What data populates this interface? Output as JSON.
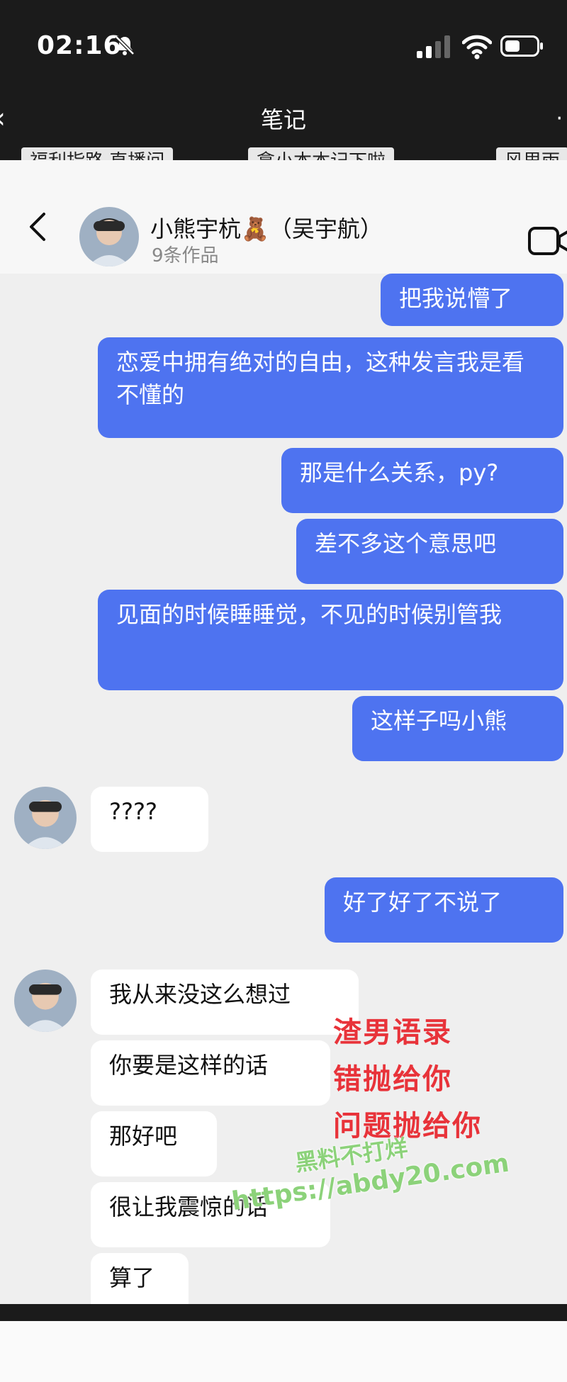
{
  "status_bar": {
    "time": "02:16"
  },
  "top_nav": {
    "title": "笔记"
  },
  "tabs": [
    "福利指路 直播间",
    "拿小本本记下啦",
    "风里雨"
  ],
  "chat_header": {
    "name": "小熊宇杭🧸（吴宇航）",
    "subtitle": "9条作品"
  },
  "messages": [
    {
      "side": "sent",
      "text": "把我说懵了"
    },
    {
      "side": "sent",
      "text": "恋爱中拥有绝对的自由，这种发言我是看不懂的"
    },
    {
      "side": "sent",
      "text": "那是什么关系，py?"
    },
    {
      "side": "sent",
      "text": "差不多这个意思吧"
    },
    {
      "side": "sent",
      "text": "见面的时候睡睡觉，不见的时候别管我"
    },
    {
      "side": "sent",
      "text": "这样子吗小熊"
    },
    {
      "side": "recv",
      "text": "????"
    },
    {
      "side": "sent",
      "text": "好了好了不说了"
    },
    {
      "side": "recv",
      "text": "我从来没这么想过"
    },
    {
      "side": "recv",
      "text": "你要是这样的话"
    },
    {
      "side": "recv",
      "text": "那好吧"
    },
    {
      "side": "recv",
      "text": "很让我震惊的话"
    },
    {
      "side": "recv",
      "text": "算了"
    }
  ],
  "overlay": {
    "line1": "渣男语录",
    "line2": "错抛给你",
    "line3": "问题抛给你"
  },
  "watermark": {
    "line1": "黑料不打烊",
    "line2": "https://abdy20.com"
  },
  "colors": {
    "sent_bubble": "#4e73f0",
    "recv_bubble": "#ffffff",
    "overlay_text": "#e8333a",
    "watermark": "#8cd27a"
  }
}
